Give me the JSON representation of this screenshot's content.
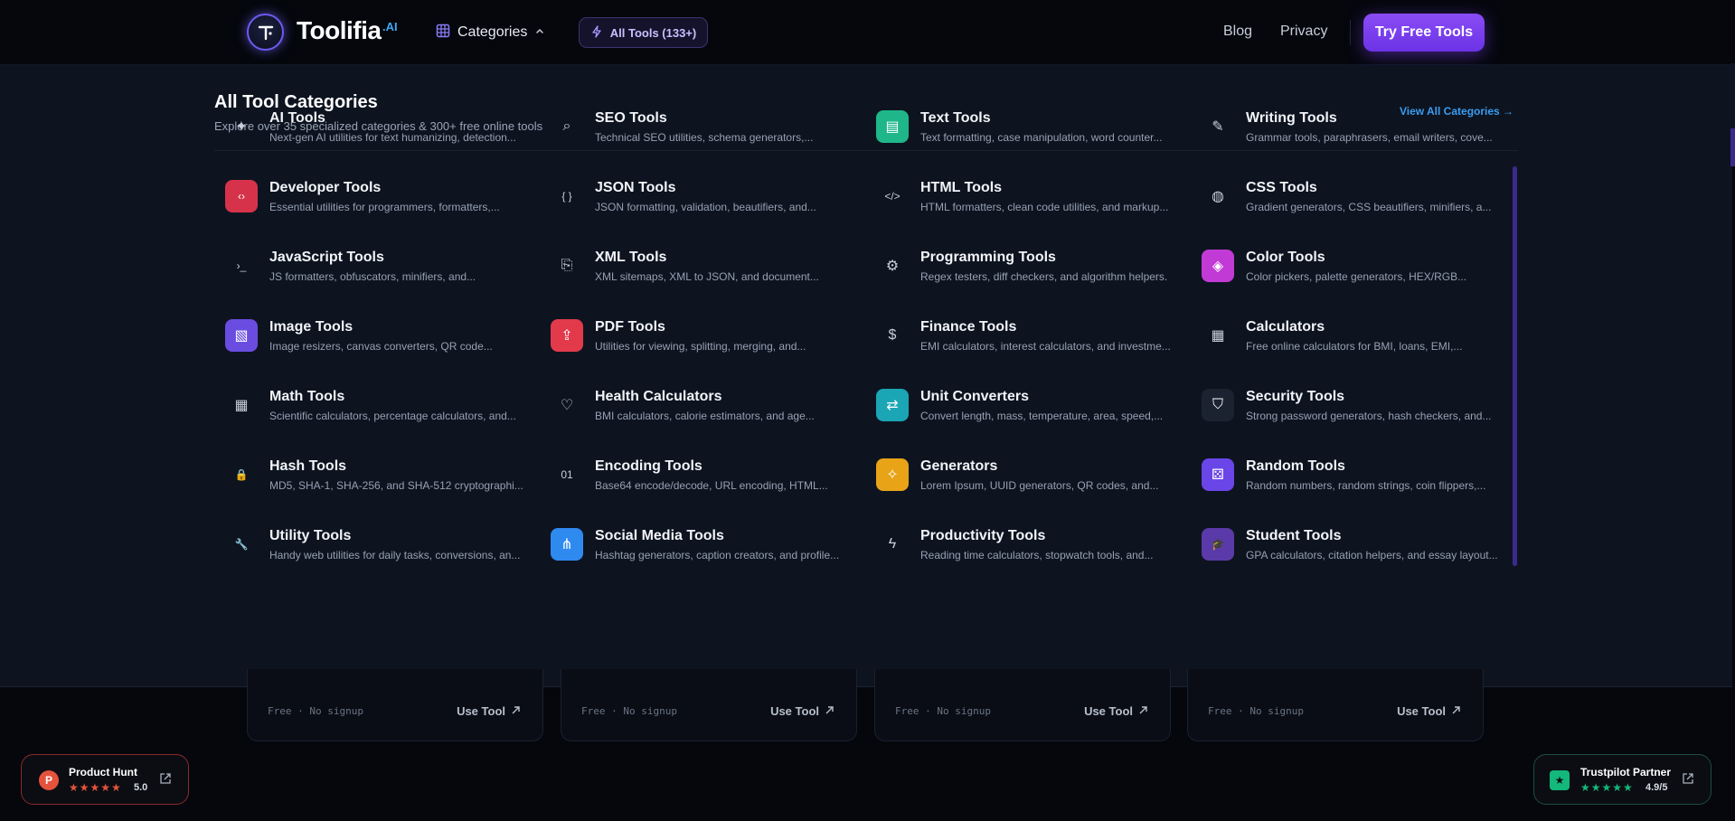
{
  "header": {
    "logo_text": "Toolifia",
    "logo_suffix": ".AI",
    "categories_label": "Categories",
    "all_tools_label": "All Tools (133+)",
    "nav": [
      "Blog",
      "Privacy"
    ],
    "cta_label": "Try Free Tools"
  },
  "menu": {
    "title": "All Tool Categories",
    "subtitle": "Explore over 35 specialized categories & 300+ free online tools",
    "view_all": "View All Categories →",
    "items": [
      {
        "name": "AI Tools",
        "desc": "Next-gen AI utilities for text humanizing, detection...",
        "icon": "sparkles-icon",
        "icon_bg": "",
        "icon_glyph": "✦"
      },
      {
        "name": "SEO Tools",
        "desc": "Technical SEO utilities, schema generators,...",
        "icon": "search-icon",
        "icon_bg": "",
        "icon_glyph": "⌕"
      },
      {
        "name": "Text Tools",
        "desc": "Text formatting, case manipulation, word counter...",
        "icon": "document-icon",
        "icon_bg": "#1fb78a",
        "icon_glyph": "▤"
      },
      {
        "name": "Writing Tools",
        "desc": "Grammar tools, paraphrasers, email writers, cove...",
        "icon": "pen-nib-icon",
        "icon_bg": "",
        "icon_glyph": "✎"
      },
      {
        "name": "Developer Tools",
        "desc": "Essential utilities for programmers, formatters,...",
        "icon": "code-brackets-icon",
        "icon_bg": "#d6334a",
        "icon_glyph": "‹›"
      },
      {
        "name": "JSON Tools",
        "desc": "JSON formatting, validation, beautifiers, and...",
        "icon": "braces-icon",
        "icon_bg": "",
        "icon_glyph": "{ }"
      },
      {
        "name": "HTML Tools",
        "desc": "HTML formatters, clean code utilities, and markup...",
        "icon": "code-icon",
        "icon_bg": "",
        "icon_glyph": "</>"
      },
      {
        "name": "CSS Tools",
        "desc": "Gradient generators, CSS beautifiers, minifiers, a...",
        "icon": "palette-icon",
        "icon_bg": "",
        "icon_glyph": "◍"
      },
      {
        "name": "JavaScript Tools",
        "desc": "JS formatters, obfuscators, minifiers, and...",
        "icon": "terminal-icon",
        "icon_bg": "",
        "icon_glyph": "›_"
      },
      {
        "name": "XML Tools",
        "desc": "XML sitemaps, XML to JSON, and document...",
        "icon": "file-code-icon",
        "icon_bg": "",
        "icon_glyph": "⎘"
      },
      {
        "name": "Programming Tools",
        "desc": "Regex testers, diff checkers, and algorithm helpers.",
        "icon": "chip-icon",
        "icon_bg": "",
        "icon_glyph": "⚙"
      },
      {
        "name": "Color Tools",
        "desc": "Color pickers, palette generators, HEX/RGB...",
        "icon": "droplet-icon",
        "icon_bg": "#c23ad6",
        "icon_glyph": "◈"
      },
      {
        "name": "Image Tools",
        "desc": "Image resizers, canvas converters, QR code...",
        "icon": "image-icon",
        "icon_bg": "#6a4de0",
        "icon_glyph": "▧"
      },
      {
        "name": "PDF Tools",
        "desc": "Utilities for viewing, splitting, merging, and...",
        "icon": "file-upload-icon",
        "icon_bg": "#e23a4a",
        "icon_glyph": "⇪"
      },
      {
        "name": "Finance Tools",
        "desc": "EMI calculators, interest calculators, and investme...",
        "icon": "dollar-icon",
        "icon_bg": "",
        "icon_glyph": "$"
      },
      {
        "name": "Calculators",
        "desc": "Free online calculators for BMI, loans, EMI,...",
        "icon": "calculator-icon",
        "icon_bg": "",
        "icon_glyph": "▦"
      },
      {
        "name": "Math Tools",
        "desc": "Scientific calculators, percentage calculators, and...",
        "icon": "calculator-icon",
        "icon_bg": "",
        "icon_glyph": "▦"
      },
      {
        "name": "Health Calculators",
        "desc": "BMI calculators, calorie estimators, and age...",
        "icon": "heart-pulse-icon",
        "icon_bg": "",
        "icon_glyph": "♡"
      },
      {
        "name": "Unit Converters",
        "desc": "Convert length, mass, temperature, area, speed,...",
        "icon": "arrows-swap-icon",
        "icon_bg": "#1aa6b5",
        "icon_glyph": "⇄"
      },
      {
        "name": "Security Tools",
        "desc": "Strong password generators, hash checkers, and...",
        "icon": "shield-icon",
        "icon_bg": "#1c2330",
        "icon_glyph": "⛉"
      },
      {
        "name": "Hash Tools",
        "desc": "MD5, SHA-1, SHA-256, and SHA-512 cryptographi...",
        "icon": "lock-icon",
        "icon_bg": "",
        "icon_glyph": "🔒"
      },
      {
        "name": "Encoding Tools",
        "desc": "Base64 encode/decode, URL encoding, HTML...",
        "icon": "binary-icon",
        "icon_bg": "",
        "icon_glyph": "01"
      },
      {
        "name": "Generators",
        "desc": "Lorem Ipsum, UUID generators, QR codes, and...",
        "icon": "magic-wand-icon",
        "icon_bg": "#e8a317",
        "icon_glyph": "✧"
      },
      {
        "name": "Random Tools",
        "desc": "Random numbers, random strings, coin flippers,...",
        "icon": "dice-icon",
        "icon_bg": "#6a45e8",
        "icon_glyph": "⚄"
      },
      {
        "name": "Utility Tools",
        "desc": "Handy web utilities for daily tasks, conversions, an...",
        "icon": "wrench-icon",
        "icon_bg": "",
        "icon_glyph": "🔧"
      },
      {
        "name": "Social Media Tools",
        "desc": "Hashtag generators, caption creators, and profile...",
        "icon": "share-icon",
        "icon_bg": "#2f8af0",
        "icon_glyph": "⋔"
      },
      {
        "name": "Productivity Tools",
        "desc": "Reading time calculators, stopwatch tools, and...",
        "icon": "lightning-icon",
        "icon_bg": "",
        "icon_glyph": "ϟ"
      },
      {
        "name": "Student Tools",
        "desc": "GPA calculators, citation helpers, and essay layout...",
        "icon": "graduation-cap-icon",
        "icon_bg": "#5a3aa8",
        "icon_glyph": "🎓"
      }
    ]
  },
  "cards": [
    {
      "meta": "Free · No signup",
      "action": "Use Tool"
    },
    {
      "meta": "Free · No signup",
      "action": "Use Tool"
    },
    {
      "meta": "Free · No signup",
      "action": "Use Tool"
    },
    {
      "meta": "Free · No signup",
      "action": "Use Tool"
    }
  ],
  "badges": {
    "product_hunt": {
      "name": "Product Hunt",
      "score": "5.0",
      "logo": "P",
      "star_color": "#e5533d"
    },
    "trustpilot": {
      "name": "Trustpilot Partner",
      "score": "4.9/5",
      "logo": "★",
      "star_color": "#14b87a"
    }
  },
  "colors": {
    "accent": "#7c3aed",
    "link": "#3b9cf0",
    "background": "#05070d",
    "panel": "#0d1420"
  }
}
